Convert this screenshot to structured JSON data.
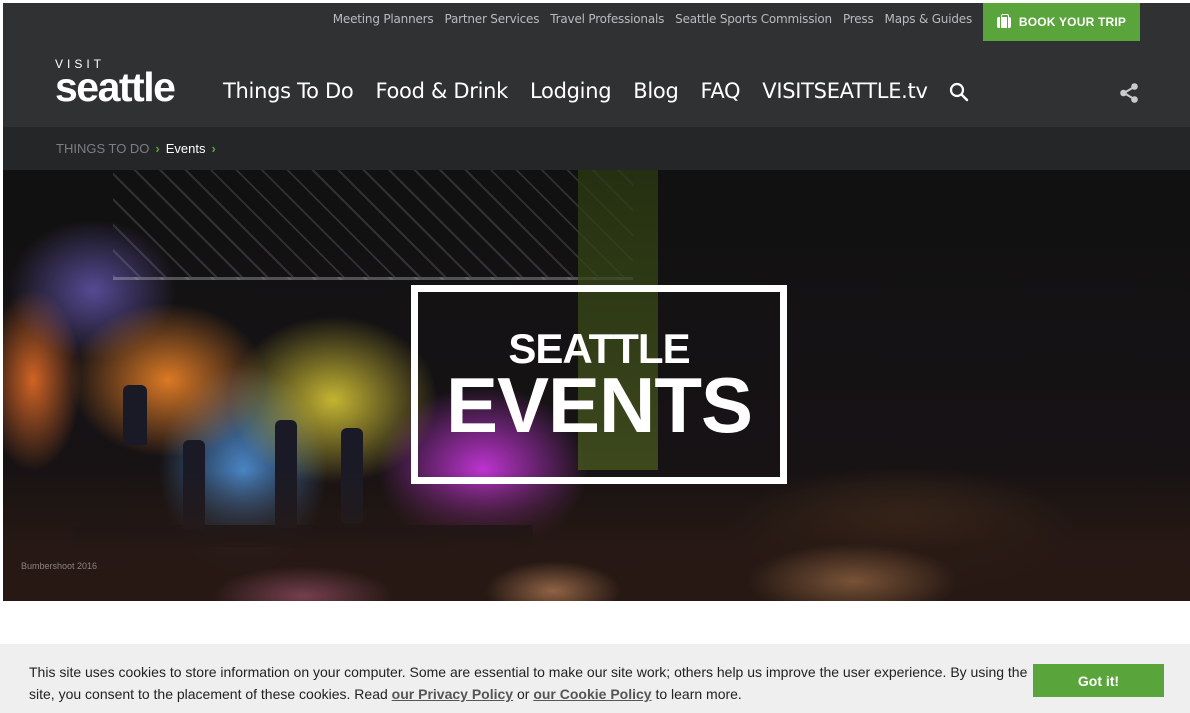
{
  "utility_nav": [
    "Meeting Planners",
    "Partner Services",
    "Travel Professionals",
    "Seattle Sports Commission",
    "Press",
    "Maps & Guides"
  ],
  "book_trip": "BOOK YOUR TRIP",
  "logo": {
    "visit": "VISIT",
    "name": "seattle"
  },
  "main_nav": [
    "Things To Do",
    "Food & Drink",
    "Lodging",
    "Blog",
    "FAQ",
    "VISITSEATTLE.tv"
  ],
  "icons": {
    "search": "search-icon",
    "share": "share-icon",
    "suitcase": "suitcase-icon"
  },
  "breadcrumb": {
    "parent": "THINGS TO DO",
    "current": "Events",
    "separator": "›"
  },
  "hero": {
    "line1": "SEATTLE",
    "line2": "EVENTS",
    "photo_credit": "Bumbershoot 2016"
  },
  "cookie": {
    "text_before": "This site uses cookies to store information on your computer. Some are essential to make our site work; others help us improve the user experience. By using the site, you consent to the placement of these cookies. Read ",
    "privacy_link": "our Privacy Policy",
    "or": " or ",
    "cookie_link": "our Cookie Policy",
    "text_after": " to learn more.",
    "button": "Got it!"
  },
  "colors": {
    "brand_green": "#5aa53b",
    "header_bg": "#2f3133",
    "breadcrumb_bg": "#242628"
  }
}
